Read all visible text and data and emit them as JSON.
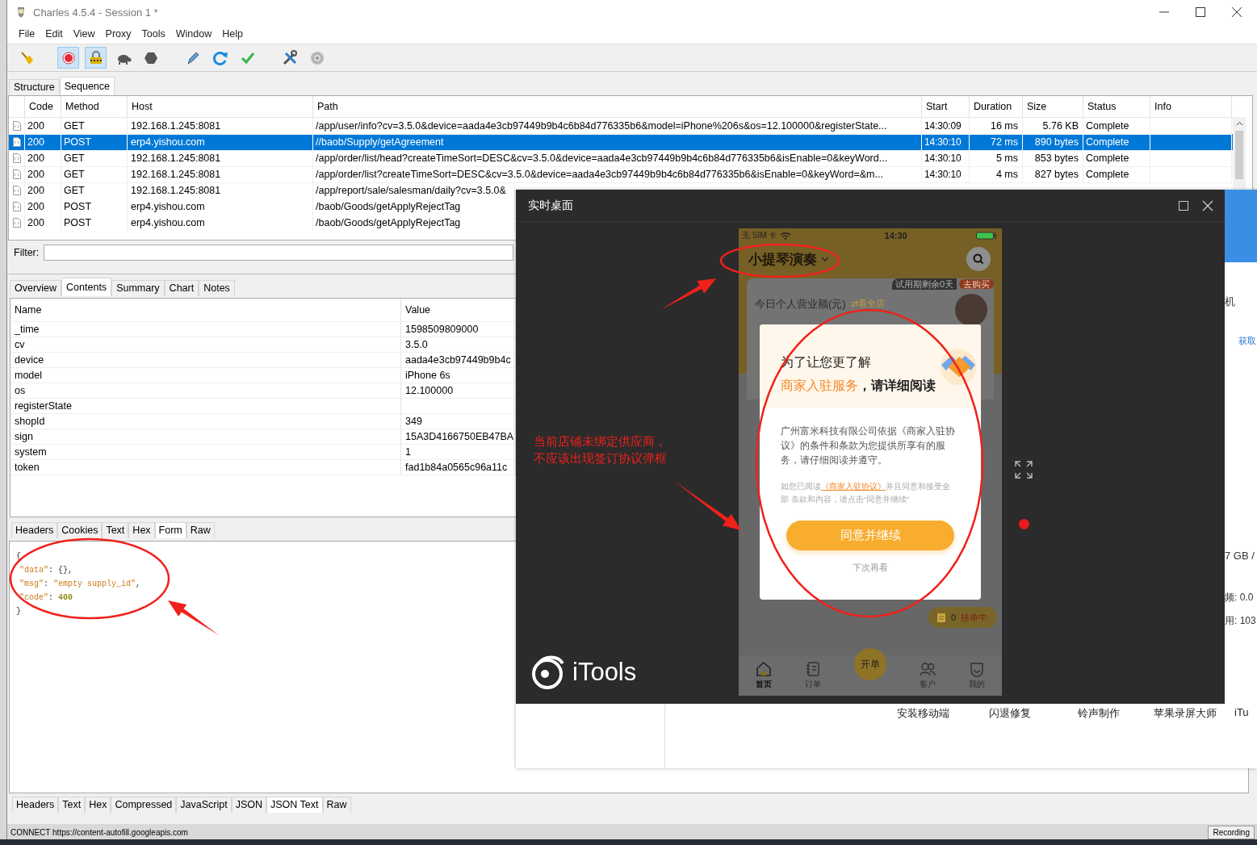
{
  "window": {
    "title": "Charles 4.5.4 - Session 1 *"
  },
  "menu": [
    "File",
    "Edit",
    "View",
    "Proxy",
    "Tools",
    "Window",
    "Help"
  ],
  "toolbar": [
    {
      "kind": "broom",
      "on": false
    },
    {
      "kind": "record",
      "on": true
    },
    {
      "kind": "lock",
      "on": true
    },
    {
      "kind": "turtle",
      "on": false
    },
    {
      "kind": "stop",
      "on": false
    },
    {
      "kind": "pen",
      "on": false
    },
    {
      "kind": "refresh",
      "on": false
    },
    {
      "kind": "check",
      "on": false
    },
    {
      "kind": "tools",
      "on": false
    },
    {
      "kind": "gear",
      "on": false
    }
  ],
  "session_tabs": [
    {
      "label": "Structure",
      "selected": false
    },
    {
      "label": "Sequence",
      "selected": true
    }
  ],
  "table": {
    "columns": [
      "Code",
      "Method",
      "Host",
      "Path",
      "Start",
      "Duration",
      "Size",
      "Status",
      "Info"
    ],
    "rows": [
      {
        "code": "200",
        "method": "GET",
        "host": "192.168.1.245:8081",
        "path": "/app/user/info?cv=3.5.0&device=aada4e3cb97449b9b4c6b84d776335b6&model=iPhone%206s&os=12.100000&registerState...",
        "start": "14:30:09",
        "duration": "16 ms",
        "size": "5.76 KB",
        "status": "Complete",
        "selected": false
      },
      {
        "code": "200",
        "method": "POST",
        "host": "erp4.yishou.com",
        "path": "//baob/Supply/getAgreement",
        "start": "14:30:10",
        "duration": "72 ms",
        "size": "890 bytes",
        "status": "Complete",
        "selected": true
      },
      {
        "code": "200",
        "method": "GET",
        "host": "192.168.1.245:8081",
        "path": "/app/order/list/head?createTimeSort=DESC&cv=3.5.0&device=aada4e3cb97449b9b4c6b84d776335b6&isEnable=0&keyWord...",
        "start": "14:30:10",
        "duration": "5 ms",
        "size": "853 bytes",
        "status": "Complete",
        "selected": false
      },
      {
        "code": "200",
        "method": "GET",
        "host": "192.168.1.245:8081",
        "path": "/app/order/list?createTimeSort=DESC&cv=3.5.0&device=aada4e3cb97449b9b4c6b84d776335b6&isEnable=0&keyWord=&m...",
        "start": "14:30:10",
        "duration": "4 ms",
        "size": "827 bytes",
        "status": "Complete",
        "selected": false
      },
      {
        "code": "200",
        "method": "GET",
        "host": "192.168.1.245:8081",
        "path": "/app/report/sale/salesman/daily?cv=3.5.0&",
        "selected": false
      },
      {
        "code": "200",
        "method": "POST",
        "host": "erp4.yishou.com",
        "path": "/baob/Goods/getApplyRejectTag",
        "selected": false
      },
      {
        "code": "200",
        "method": "POST",
        "host": "erp4.yishou.com",
        "path": "/baob/Goods/getApplyRejectTag",
        "selected": false
      }
    ]
  },
  "filter": {
    "label": "Filter:"
  },
  "detail_tabs": [
    {
      "label": "Overview",
      "selected": false
    },
    {
      "label": "Contents",
      "selected": true
    },
    {
      "label": "Summary",
      "selected": false
    },
    {
      "label": "Chart",
      "selected": false
    },
    {
      "label": "Notes",
      "selected": false
    }
  ],
  "params": {
    "columns": [
      "Name",
      "Value"
    ],
    "rows": [
      {
        "name": "_time",
        "value": "1598509809000"
      },
      {
        "name": "cv",
        "value": "3.5.0"
      },
      {
        "name": "device",
        "value": "aada4e3cb97449b9b4c"
      },
      {
        "name": "model",
        "value": "iPhone 6s"
      },
      {
        "name": "os",
        "value": "12.100000"
      },
      {
        "name": "registerState"
      },
      {
        "name": "shopId",
        "value": "349"
      },
      {
        "name": "sign",
        "value": "15A3D4166750EB47BA"
      },
      {
        "name": "system",
        "value": "1"
      },
      {
        "name": "token",
        "value": "fad1b84a0565c96a11c"
      }
    ]
  },
  "request_tabs": [
    {
      "label": "Headers",
      "selected": false
    },
    {
      "label": "Cookies",
      "selected": false
    },
    {
      "label": "Text",
      "selected": false
    },
    {
      "label": "Hex",
      "selected": false
    },
    {
      "label": "Form",
      "selected": true
    },
    {
      "label": "Raw",
      "selected": false
    }
  ],
  "json_body": [
    [
      {
        "t": "{",
        "kind": "punct"
      }
    ],
    [
      {
        "t": "\"data\"",
        "kind": "key"
      },
      {
        "t": ": {},",
        "kind": "punct"
      }
    ],
    [
      {
        "t": "\"msg\"",
        "kind": "key"
      },
      {
        "t": ": ",
        "kind": "punct"
      },
      {
        "t": "\"empty supply_id\"",
        "kind": "string"
      },
      {
        "t": ",",
        "kind": "punct"
      }
    ],
    [
      {
        "t": "\"code\"",
        "kind": "key"
      },
      {
        "t": ": ",
        "kind": "punct"
      },
      {
        "t": "400",
        "kind": "number"
      }
    ],
    [
      {
        "t": "}",
        "kind": "punct"
      }
    ]
  ],
  "response_tabs": [
    {
      "label": "Headers",
      "selected": false
    },
    {
      "label": "Text",
      "selected": false
    },
    {
      "label": "Hex",
      "selected": false
    },
    {
      "label": "Compressed",
      "selected": false
    },
    {
      "label": "JavaScript",
      "selected": false
    },
    {
      "label": "JSON",
      "selected": false
    },
    {
      "label": "JSON Text",
      "selected": true
    },
    {
      "label": "Raw",
      "selected": false
    }
  ],
  "status_bar": {
    "text": "CONNECT https://content-autofill.googleapis.com",
    "button": "Recording"
  },
  "itools_main": {
    "side_texts": [
      "机",
      "获取",
      "7 GB /",
      "频: 0.0",
      "用: 103"
    ],
    "links": [
      "安装移动端",
      "闪退修复",
      "铃声制作",
      "苹果录屏大师",
      "iTu"
    ]
  },
  "live_window": {
    "title": "实时桌面",
    "logo": "iTools",
    "phone": {
      "carrier": "无 SIM 卡",
      "time": "14:30",
      "store": "小提琴演奏",
      "trial": "试用期剩余0天",
      "buy": "去购买",
      "revenue_label": "今日个人营业额(元)",
      "switch_icon": "⇄",
      "switch_label": "看全店",
      "dialog": {
        "heading": "为了让您更了解",
        "highlight": "商家入驻服务",
        "heading_rest": "，请详细阅读",
        "body": "广州富米科技有限公司依据《商家入驻协议》的条件和条款为您提供所享有的服务，请仔细阅读并遵守。",
        "notice_before": "如您已阅读",
        "notice_link": "《商家入驻协议》",
        "notice_after": "并且同意和接受全部 条款和内容，请点击“同意并继续”",
        "button": "同意并继续",
        "later": "下次再看"
      },
      "pending_count": "0",
      "pending_label": "挂单中",
      "tabbar": [
        {
          "kind": "home",
          "label": "首页",
          "selected": true
        },
        {
          "kind": "orders",
          "label": "订单",
          "selected": false
        },
        {
          "kind": "fab",
          "label": "开单"
        },
        {
          "kind": "customers",
          "label": "客户",
          "selected": false
        },
        {
          "kind": "profile",
          "label": "我的",
          "selected": false
        }
      ]
    }
  },
  "annotation": {
    "text": "当前店铺未绑定供应商，不应该出现签订协议弹框"
  }
}
